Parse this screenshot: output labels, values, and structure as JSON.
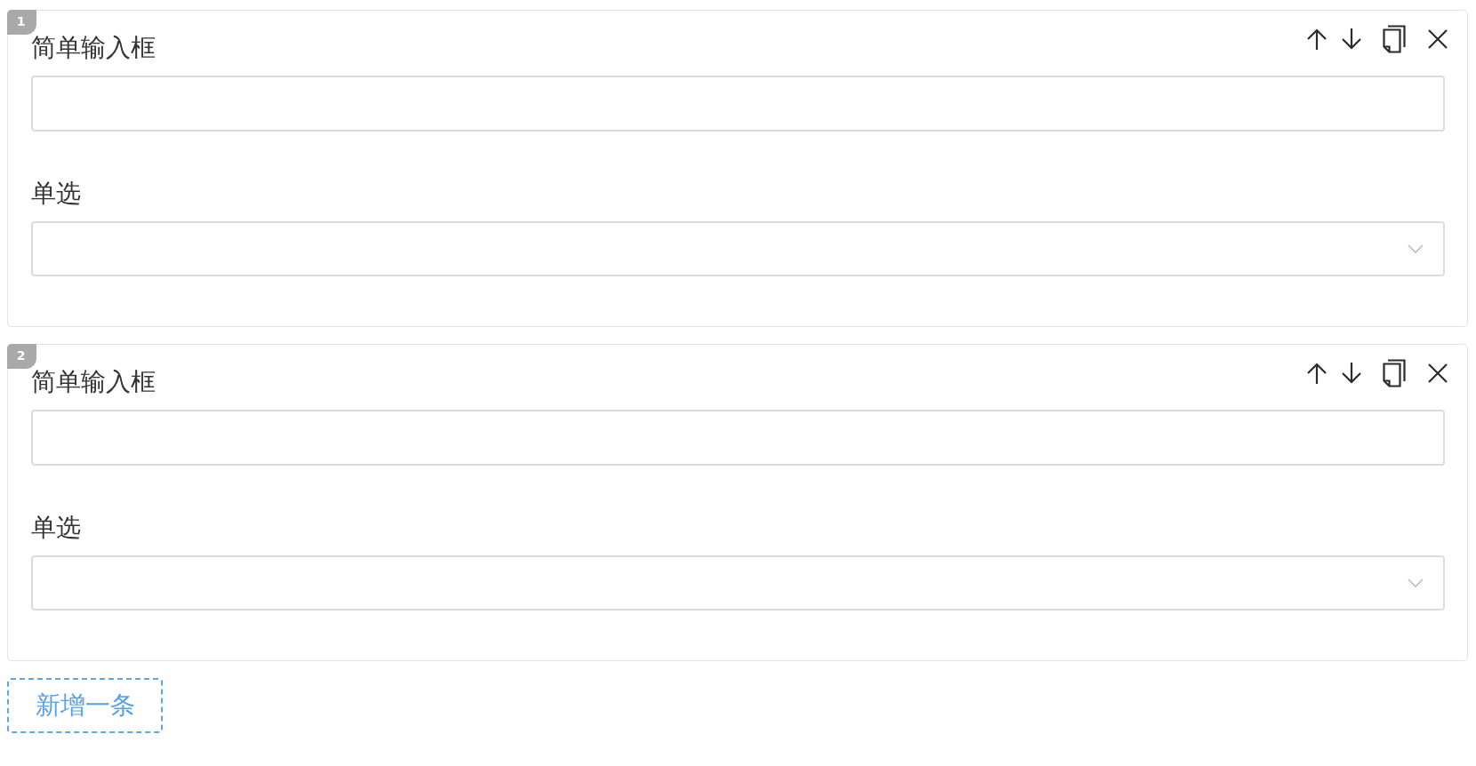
{
  "cards": [
    {
      "badge": "1",
      "fields": [
        {
          "kind": "text",
          "label": "简单输入框"
        },
        {
          "kind": "select",
          "label": "单选"
        }
      ]
    },
    {
      "badge": "2",
      "fields": [
        {
          "kind": "text",
          "label": "简单输入框"
        },
        {
          "kind": "select",
          "label": "单选"
        }
      ]
    }
  ],
  "add_button": {
    "label": "新增一条"
  }
}
